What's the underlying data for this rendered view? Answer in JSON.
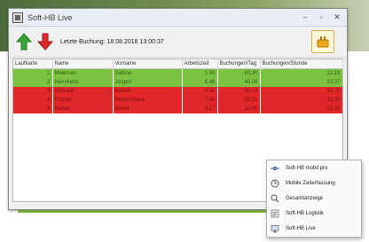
{
  "window": {
    "title": "Soft-HB Live",
    "controls": {
      "minimize": "–",
      "maximize": "▫",
      "close": "✕"
    }
  },
  "toolbar": {
    "up_icon": "green-up-arrow-icon",
    "down_icon": "red-down-arrow-icon",
    "last_booking_label": "Letzte Buchung: 18.08.2018 13:00:37",
    "plugin_icon": "plugin-icon"
  },
  "table": {
    "columns": [
      "Laufkarte",
      "Name",
      "Vorname",
      "Arbeitszeit",
      "Buchungen/Tag",
      "Buchungen/Stunde"
    ],
    "rows": [
      {
        "status": "green",
        "cells": [
          "1",
          "Meiersen",
          "Sabine",
          "1,59",
          "40,30",
          "22,18"
        ]
      },
      {
        "status": "green",
        "cells": [
          "2",
          "Henrikens",
          "Jorgen",
          "6,48",
          "40,08",
          "22,07"
        ]
      },
      {
        "status": "red",
        "cells": [
          "3",
          "Schmidt",
          "Bertolt",
          "3,41",
          "30,03",
          "10,70"
        ]
      },
      {
        "status": "red",
        "cells": [
          "4",
          "Fischer",
          "Niklas-Maria",
          "7,48",
          "20,51",
          "11,80"
        ]
      },
      {
        "status": "red",
        "cells": [
          "5",
          "Weber",
          "Bernd",
          "3,17",
          "18,00",
          "10,41"
        ]
      }
    ]
  },
  "context_menu": {
    "items": [
      {
        "label": "Soft-HB mobil pro",
        "icon": "satellite-icon"
      },
      {
        "label": "Mobile Zeiterfassung",
        "icon": "clock-icon"
      },
      {
        "label": "Gesamtanzeige",
        "icon": "search-icon"
      },
      {
        "label": "Soft-HB Logistik",
        "icon": "list-icon"
      },
      {
        "label": "Soft-HB Live",
        "icon": "monitor-icon"
      }
    ]
  }
}
